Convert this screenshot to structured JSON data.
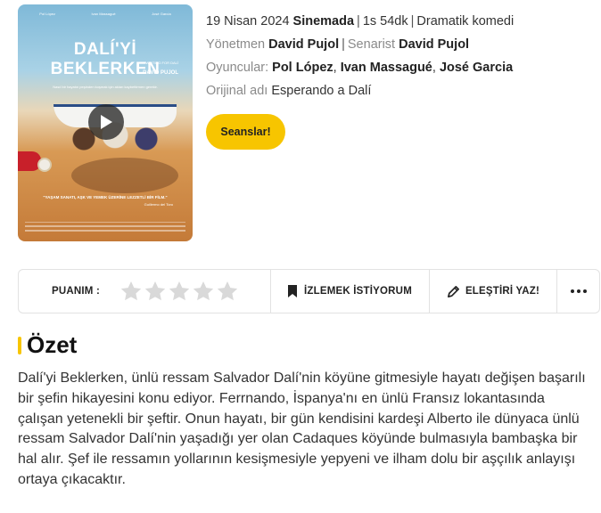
{
  "poster": {
    "cast_names": [
      "Pol López",
      "Ivan Massagué",
      "José García"
    ],
    "title": "DALÍ'Yİ BEKLERKEN",
    "subtitle": "WAITING FOR DALÍ",
    "director_credit": "DAVID PUJOL",
    "tagline": "Nasıl bir hayatın peşinden koşmak için akları kaybettirmen gerekir.",
    "quote": "\"YAŞAM SANATI, AŞK VE YEMEK ÜZERİNE LEZZETLİ BİR FİLM.\"",
    "quote_source": "Guillermo del Toro",
    "play_label": "play-icon"
  },
  "info": {
    "date": "19 Nisan 2024",
    "status": "Sinemada",
    "duration": "1s 54dk",
    "genre": "Dramatik komedi",
    "director_label": "Yönetmen",
    "director": "David Pujol",
    "writer_label": "Senarist",
    "writer": "David Pujol",
    "cast_label": "Oyuncular:",
    "cast": [
      "Pol López",
      "Ivan Massagué",
      "José Garcia"
    ],
    "original_label": "Orijinal adı",
    "original_title": "Esperando a Dalí"
  },
  "seans_button": "Seanslar!",
  "actions": {
    "rating_label": "PUANIM :",
    "rating_value": 0,
    "rating_max": 5,
    "watch_label": "İZLEMEK İSTİYORUM",
    "critic_label": "ELEŞTİRİ YAZ!",
    "more_label": "•••"
  },
  "summary": {
    "title": "Özet",
    "text": "Dalí'yi Beklerken, ünlü ressam Salvador Dalí'nin köyüne gitmesiyle hayatı değişen başarılı bir şefin hikayesini konu ediyor. Ferrnando, İspanya'nı en ünlü Fransız lokantasında çalışan yetenekli bir şeftir. Onun hayatı, bir gün kendisini kardeşi Alberto ile dünyaca ünlü ressam Salvador Dalí'nin yaşadığı yer olan Cadaques köyünde bulmasıyla bambaşka bir hal alır. Şef ile ressamın yollarının kesişmesiyle yepyeni ve ilham dolu bir aşçılık anlayışı ortaya çıkacaktır."
  },
  "colors": {
    "accent": "#f7c500",
    "star_empty": "#d9d9d9"
  }
}
